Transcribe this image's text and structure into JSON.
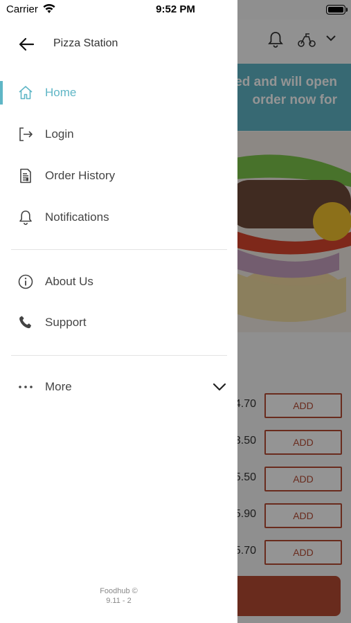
{
  "status_bar": {
    "carrier": "Carrier",
    "time": "9:52 PM"
  },
  "drawer": {
    "title": "Pizza Station",
    "items": [
      {
        "label": "Home",
        "icon": "home-icon",
        "active": true
      },
      {
        "label": "Login",
        "icon": "login-icon"
      },
      {
        "label": "Order History",
        "icon": "receipt-icon"
      },
      {
        "label": "Notifications",
        "icon": "bell-icon"
      }
    ],
    "info_items": [
      {
        "label": "About Us",
        "icon": "info-icon"
      },
      {
        "label": "Support",
        "icon": "phone-icon"
      }
    ],
    "more_label": "More",
    "footer": {
      "brand": "Foodhub ©",
      "version": "9.11 - 2"
    }
  },
  "background": {
    "banner_line1": "ed and will open",
    "banner_line2": "order now for",
    "menu_items": [
      {
        "price": "4.70",
        "button": "ADD"
      },
      {
        "price": "3.50",
        "button": "ADD"
      },
      {
        "price": "5.50",
        "button": "ADD"
      },
      {
        "price": "5.90",
        "button": "ADD"
      },
      {
        "price": "5.70",
        "button": "ADD"
      }
    ]
  },
  "colors": {
    "accent": "#5fb6c6",
    "brand_red": "#b64a33",
    "overlay": "rgba(0,0,0,0.42)"
  }
}
